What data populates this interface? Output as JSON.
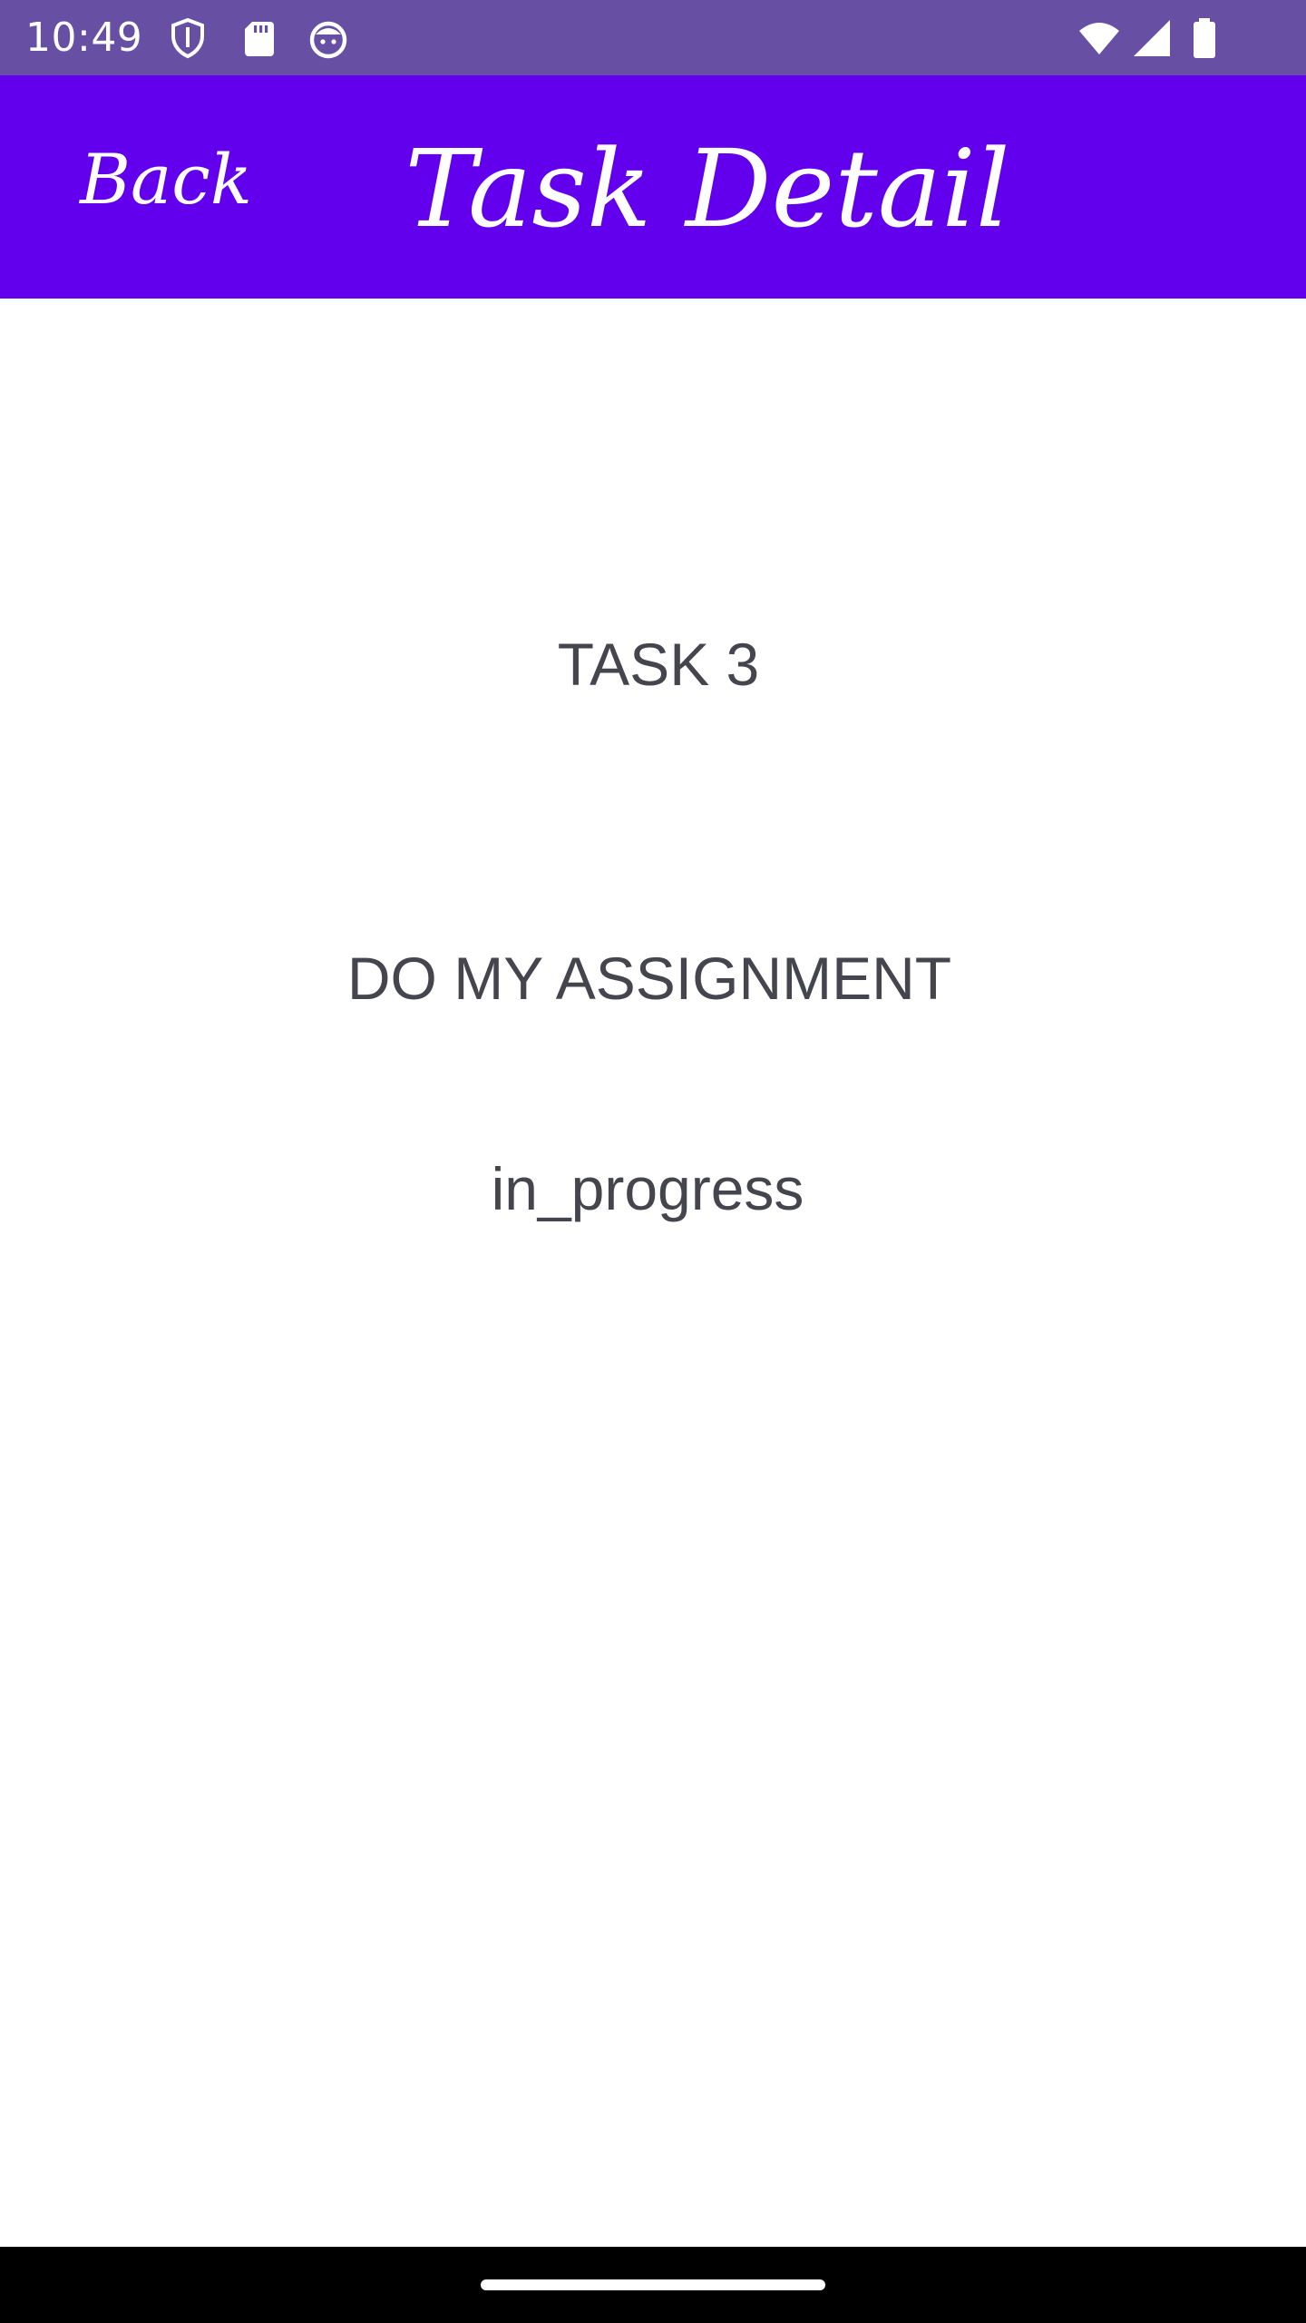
{
  "status_bar": {
    "time": "10:49",
    "icons_left": [
      "shield-icon",
      "sd-card-icon",
      "robot-face-icon"
    ],
    "icons_right": [
      "wifi-icon",
      "cell-signal-icon",
      "battery-icon"
    ],
    "background": "#6750a4"
  },
  "app_bar": {
    "back_label": "Back",
    "title": "Task Detail",
    "background": "#6200ee"
  },
  "task": {
    "name": "TASK 3",
    "description": "DO MY ASSIGNMENT",
    "status": "in_progress"
  },
  "nav_bar": {
    "background": "#000000"
  }
}
